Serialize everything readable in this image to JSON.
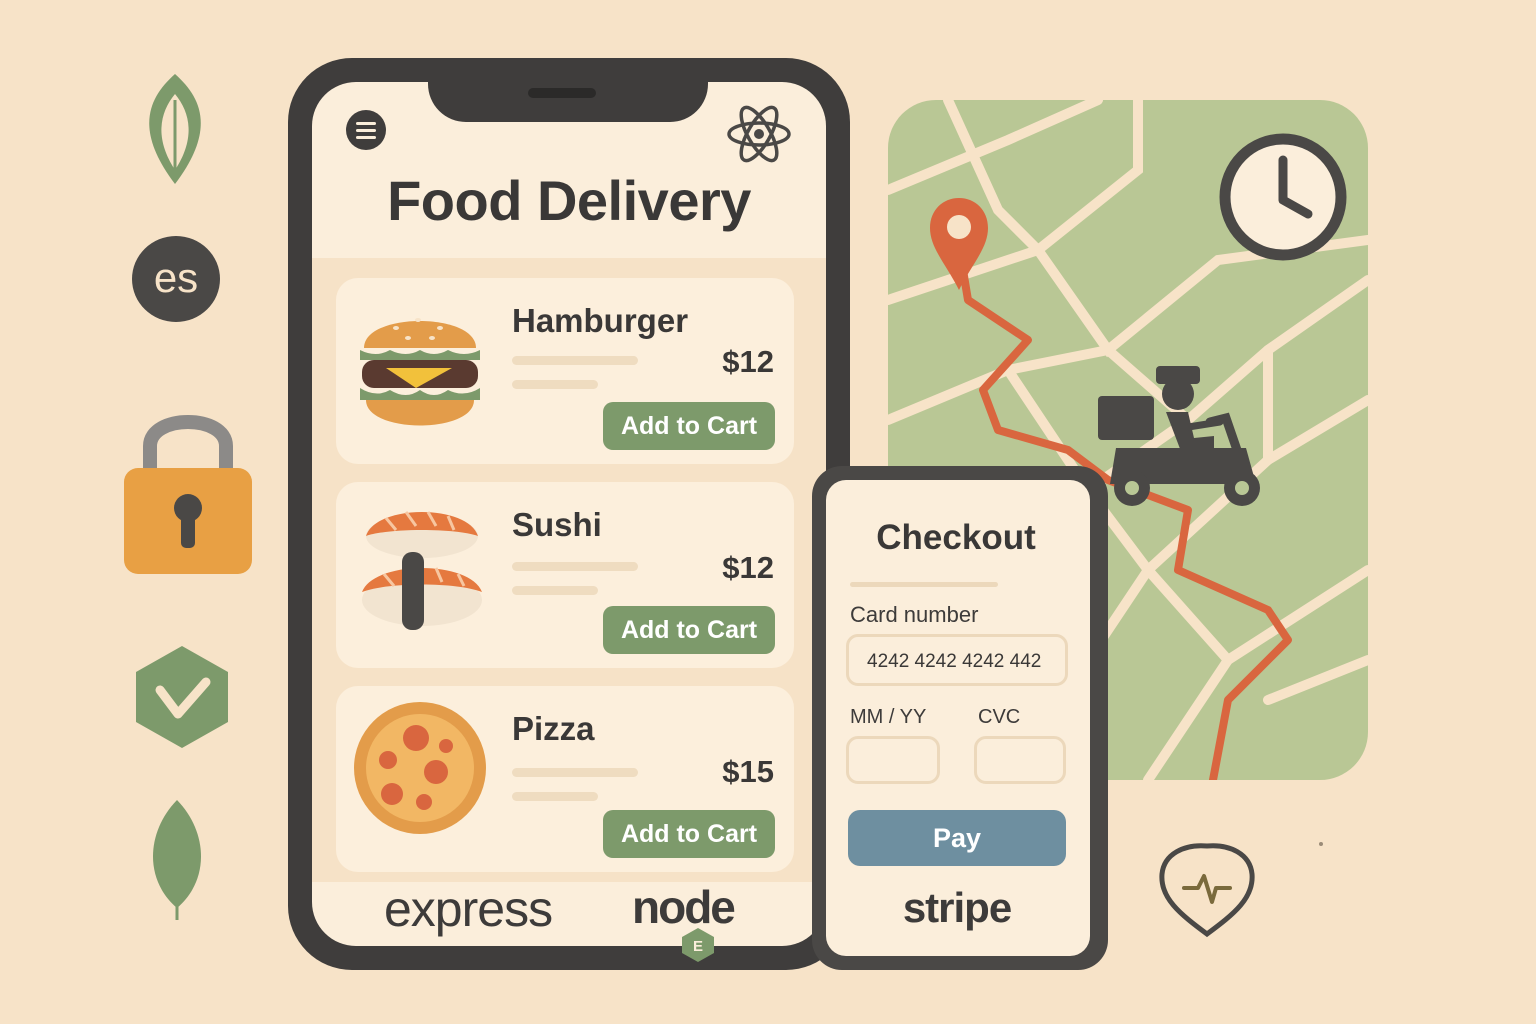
{
  "app": {
    "title": "Food Delivery"
  },
  "menu": [
    {
      "name": "Hamburger",
      "price": "$12",
      "button": "Add to Cart",
      "image_icon": "hamburger-icon"
    },
    {
      "name": "Sushi",
      "price": "$12",
      "button": "Add to Cart",
      "image_icon": "sushi-icon"
    },
    {
      "name": "Pizza",
      "price": "$15",
      "button": "Add to Cart",
      "image_icon": "pizza-icon"
    }
  ],
  "footer": {
    "express": "express",
    "node": "node",
    "badge": "E"
  },
  "side_icons": {
    "es": "es",
    "items": [
      "mongodb-leaf-icon",
      "es-badge-icon",
      "lock-icon",
      "vue-hex-icon",
      "leaf-icon"
    ]
  },
  "checkout": {
    "title": "Checkout",
    "card_label": "Card number",
    "card_value": "4242 4242 4242 442",
    "expiry_label": "MM / YY",
    "cvc_label": "CVC",
    "expiry_value": "",
    "cvc_value": "",
    "pay_label": "Pay",
    "provider": "stripe"
  },
  "map": {
    "icons": [
      "location-pin-icon",
      "clock-icon",
      "delivery-scooter-icon",
      "route-line"
    ]
  },
  "colors": {
    "background": "#f7e3c8",
    "accent_green": "#7d9a6b",
    "route_orange": "#d9663f",
    "pay_blue": "#6e8fa0",
    "lock_orange": "#e8a044",
    "dark": "#3f3d3c"
  }
}
